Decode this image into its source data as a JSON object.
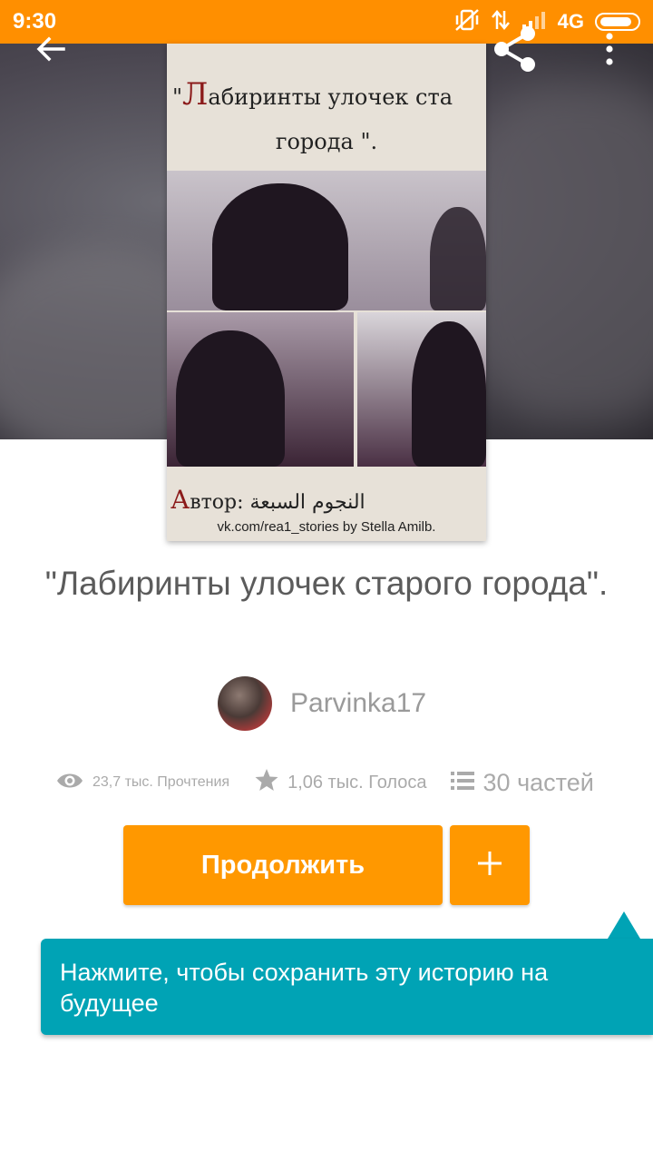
{
  "status_bar": {
    "time": "9:30",
    "network": "4G",
    "icons": [
      "vibrate-off-icon",
      "data-arrows-icon",
      "signal-icon",
      "battery-icon"
    ]
  },
  "header": {
    "back_icon": "arrow-back-icon",
    "share_icon": "share-icon",
    "menu_icon": "more-vert-icon"
  },
  "cover": {
    "title_line1_first": "Л",
    "title_line1_rest": "абиринты улочек ста",
    "title_line1_quote": "\"",
    "title_line2": "города \".",
    "author_first": "А",
    "author_rest": "втор: النجوم السبعة",
    "url": "vk.com/rea1_stories by Stella Amilb."
  },
  "story": {
    "title": "\"Лабиринты улочек старого города\".",
    "author": "Parvinka17"
  },
  "stats": {
    "reads": "23,7 тыс. Прочтения",
    "votes": "1,06 тыс. Голоса",
    "parts": "30 частей"
  },
  "actions": {
    "continue_label": "Продолжить",
    "add_icon": "plus-icon"
  },
  "tooltip": {
    "text": "Нажмите, чтобы сохранить эту историю на будущее"
  },
  "colors": {
    "accent": "#ff9800",
    "status_bar": "#ff8f00",
    "tooltip": "#00a3b5"
  }
}
